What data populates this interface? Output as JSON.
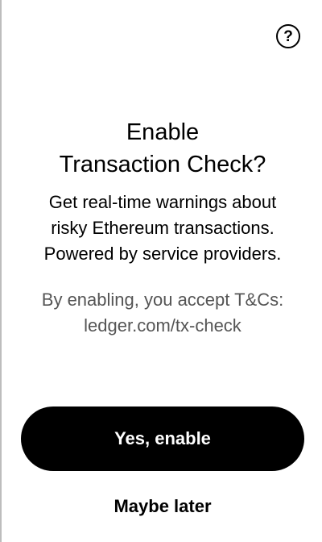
{
  "header": {
    "help_icon": "question-circle-icon",
    "help_glyph": "?"
  },
  "content": {
    "title_lines": [
      "Enable",
      "Transaction Check?"
    ],
    "description_lines": [
      "Get real-time warnings about",
      "risky Ethereum transactions.",
      "Powered by service providers."
    ],
    "terms_lines": [
      "By enabling, you accept T&Cs:",
      "ledger.com/tx-check"
    ]
  },
  "actions": {
    "primary_label": "Yes, enable",
    "secondary_label": "Maybe later"
  },
  "colors": {
    "background": "#ffffff",
    "text": "#000000",
    "muted_text": "#555555",
    "primary_button_bg": "#000000",
    "primary_button_text": "#ffffff"
  }
}
